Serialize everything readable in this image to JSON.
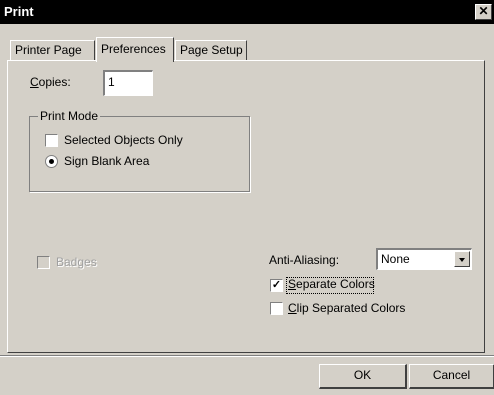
{
  "window": {
    "title": "Print",
    "close_glyph": "✕"
  },
  "tabs": [
    {
      "label": "Printer Page",
      "active": false
    },
    {
      "label": "Preferences",
      "active": true
    },
    {
      "label": "Page Setup",
      "active": false
    }
  ],
  "preferences": {
    "copies": {
      "label_prefix": "C",
      "label_rest": "opies:",
      "value": "1"
    },
    "print_mode": {
      "label": "Print Mode",
      "selected_objects_only": {
        "label": "Selected Objects Only",
        "checked": false
      },
      "sign_blank_area": {
        "label": "Sign Blank Area",
        "selected": true
      }
    },
    "badges": {
      "label": "Badges",
      "checked": false,
      "enabled": false
    },
    "anti_aliasing": {
      "label": "Anti-Aliasing:",
      "value": "None"
    },
    "separate_colors": {
      "label_prefix": "S",
      "label_rest": "eparate Colors",
      "checked": true,
      "check_glyph": "✓"
    },
    "clip_separated_colors": {
      "label_prefix": "C",
      "label_rest": "lip Separated Colors",
      "checked": false
    }
  },
  "buttons": {
    "ok": "OK",
    "cancel": "Cancel"
  },
  "icons": {
    "close": "close-icon",
    "dropdown": "chevron-down-icon"
  },
  "colors": {
    "face": "#d4d0c8",
    "titlebar": "#000000",
    "disabled_text": "#a0a0a0"
  }
}
